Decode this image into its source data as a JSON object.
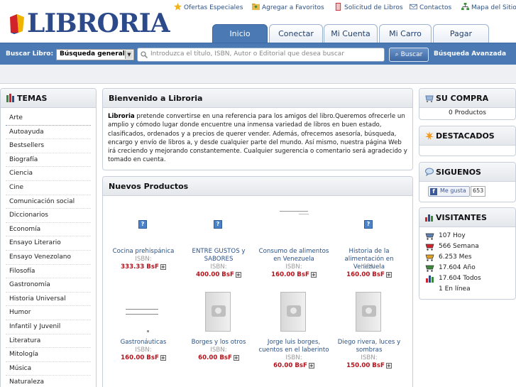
{
  "header": {
    "logo_text": "LIBRORIA",
    "links": [
      {
        "label": "Ofertas Especiales",
        "icon": "star-icon"
      },
      {
        "label": "Agregar a Favoritos",
        "icon": "folder-icon"
      },
      {
        "label": "Solicitud de Libros",
        "icon": "book-icon"
      },
      {
        "label": "Contactos",
        "icon": "mail-icon"
      },
      {
        "label": "Mapa del Sitio",
        "icon": "sitemap-icon"
      }
    ]
  },
  "tabs": [
    {
      "label": "Inicio",
      "active": true
    },
    {
      "label": "Conectar"
    },
    {
      "label": "Mi Cuenta"
    },
    {
      "label": "Mi Carro"
    },
    {
      "label": "Pagar"
    }
  ],
  "search": {
    "label": "Buscar Libro:",
    "select_value": "Búsqueda general",
    "placeholder": "Introduzca el título, ISBN, Autor o Editorial que desea buscar",
    "button": "Buscar",
    "advanced": "Búsqueda Avanzada"
  },
  "temas": {
    "title": "TEMAS",
    "items": [
      "Arte",
      "Autoayuda",
      "Bestsellers",
      "Biografía",
      "Ciencia",
      "Cine",
      "Comunicación social",
      "Diccionarios",
      "Economía",
      "Ensayo Literario",
      "Ensayo Venezolano",
      "Filosofía",
      "Gastronomía",
      "Historia Universal",
      "Humor",
      "Infantil y Juvenil",
      "Literatura",
      "Mitología",
      "Música",
      "Naturaleza"
    ]
  },
  "welcome": {
    "title": "Bienvenido a Libroria",
    "brand": "Libroria",
    "text": " pretende convertirse en una referencia para los amigos del libro.Queremos ofrecerle un amplio y cómodo lugar donde encuentre una inmensa variedad de libros en buen estado, clasificados, ordenados y a precios de querer vender. Además, ofrecemos asesoría, búsqueda, encargo y envío de libros a, y desde cualquier parte del mundo. Así mismo, nuestra página Web irá creciendo y mejorando constantemente. Cualquier sugerencia o comentario será agradecido y tomado en cuenta."
  },
  "nuevos": {
    "title": "Nuevos Productos",
    "isbn_label": "ISBN:",
    "products": [
      {
        "title": "Cocina prehispánica",
        "price": "333.33 BsF"
      },
      {
        "title": "ENTRE GUSTOS y SABORES",
        "price": "400.00 BsF"
      },
      {
        "title": "Consumo de alimentos en Venezuela",
        "price": "160.00 BsF"
      },
      {
        "title": "Historia de la alimentación en Venezuela",
        "price": "160.00 BsF"
      },
      {
        "title": "Gastronáuticas",
        "price": "160.00 BsF"
      },
      {
        "title": "Borges y los otros",
        "price": "60.00 BsF"
      },
      {
        "title": "Jorge luis borges, cuentos en el laberinto",
        "price": "60.00 BsF"
      },
      {
        "title": "Diego rivera, luces y sombras",
        "price": "150.00 BsF"
      }
    ]
  },
  "compra": {
    "title": "SU COMPRA",
    "text": "0 Productos"
  },
  "destacados": {
    "title": "DESTACADOS"
  },
  "siguenos": {
    "title": "SIGUENOS",
    "like": "Me gusta",
    "count": "653"
  },
  "visitantes": {
    "title": "VISITANTES",
    "rows": [
      "107 Hoy",
      "566 Semana",
      "6.253 Mes",
      "17.604 Año",
      "17.604 Todos",
      "1 En línea"
    ]
  },
  "colors": {
    "accent": "#4a79b4",
    "price": "#b5121b",
    "link": "#2b5185"
  }
}
